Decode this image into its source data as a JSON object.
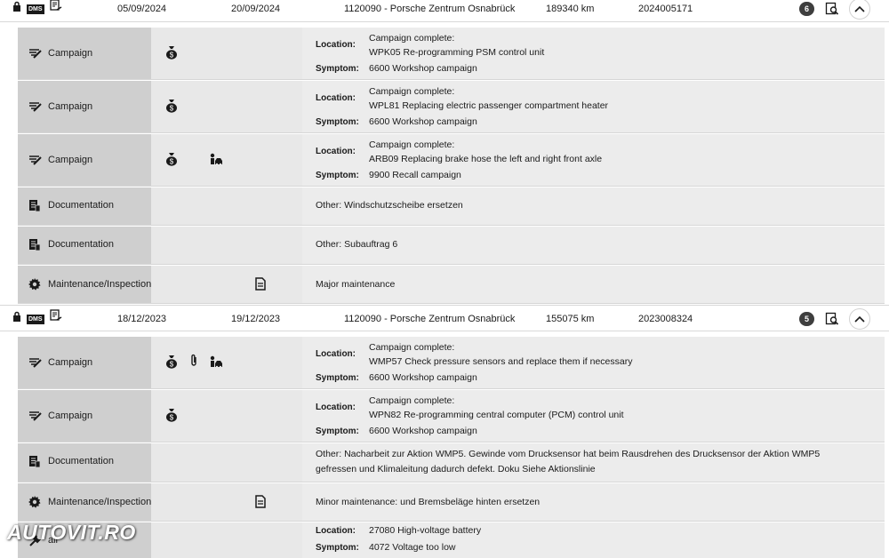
{
  "visits": [
    {
      "date_from": "05/09/2024",
      "date_to": "20/09/2024",
      "dealer": "1120090 - Porsche Zentrum Osnabrück",
      "mileage": "189340 km",
      "order": "2024005171",
      "count": "6",
      "rows": [
        {
          "type": "Campaign",
          "location_label": "Location:",
          "location_lines": [
            "Campaign complete:",
            "WPK05 Re-programming PSM control unit"
          ],
          "symptom_label": "Symptom:",
          "symptom": "6600 Workshop campaign"
        },
        {
          "type": "Campaign",
          "location_label": "Location:",
          "location_lines": [
            "Campaign complete:",
            "WPL81 Replacing electric passenger compartment heater"
          ],
          "symptom_label": "Symptom:",
          "symptom": "6600 Workshop campaign"
        },
        {
          "type": "Campaign",
          "location_label": "Location:",
          "location_lines": [
            "Campaign complete:",
            "ARB09 Replacing brake hose the left and right front axle"
          ],
          "symptom_label": "Symptom:",
          "symptom": "9900 Recall campaign"
        },
        {
          "type": "Documentation",
          "text": "Other: Windschutzscheibe ersetzen"
        },
        {
          "type": "Documentation",
          "text": "Other: Subauftrag 6"
        },
        {
          "type": "Maintenance/Inspection",
          "text": "Major maintenance"
        }
      ]
    },
    {
      "date_from": "18/12/2023",
      "date_to": "19/12/2023",
      "dealer": "1120090 - Porsche Zentrum Osnabrück",
      "mileage": "155075 km",
      "order": "2023008324",
      "count": "5",
      "rows": [
        {
          "type": "Campaign",
          "location_label": "Location:",
          "location_lines": [
            "Campaign complete:",
            "WMP57 Check pressure sensors and replace them if necessary"
          ],
          "symptom_label": "Symptom:",
          "symptom": "6600 Workshop campaign"
        },
        {
          "type": "Campaign",
          "location_label": "Location:",
          "location_lines": [
            "Campaign complete:",
            "WPN82 Re-programming central computer (PCM) control unit"
          ],
          "symptom_label": "Symptom:",
          "symptom": "6600 Workshop campaign"
        },
        {
          "type": "Documentation",
          "text": "Other: Nacharbeit zur Aktion WMP5. Gewinde vom Drucksensor hat beim Rausdrehen des Drucksensor der Aktion WMP5 gefressen und Klimaleitung dadurch defekt. Doku Siehe Aktionslinie"
        },
        {
          "type": "Maintenance/Inspection",
          "text": "Minor maintenance: und Bremsbeläge hinten ersetzen"
        },
        {
          "type": "Repair",
          "type_partial": "air",
          "location_label": "Location:",
          "location": "27080 High-voltage battery",
          "symptom_label": "Symptom:",
          "symptom": "4072 Voltage too low"
        }
      ]
    }
  ],
  "header_badges": {
    "dms": "DMS"
  },
  "watermark": "AUTOVIT.RO",
  "icons": {
    "lock": "lock-icon",
    "document_sign": "document-sign-icon",
    "campaign": "campaign-icon",
    "documentation": "documentation-icon",
    "maintenance": "gear-icon",
    "money_bag": "money-bag-icon",
    "paperclip": "paperclip-icon",
    "person_car": "person-car-icon",
    "note": "note-icon",
    "search": "search-icon",
    "collapse": "chevron-up-icon"
  }
}
